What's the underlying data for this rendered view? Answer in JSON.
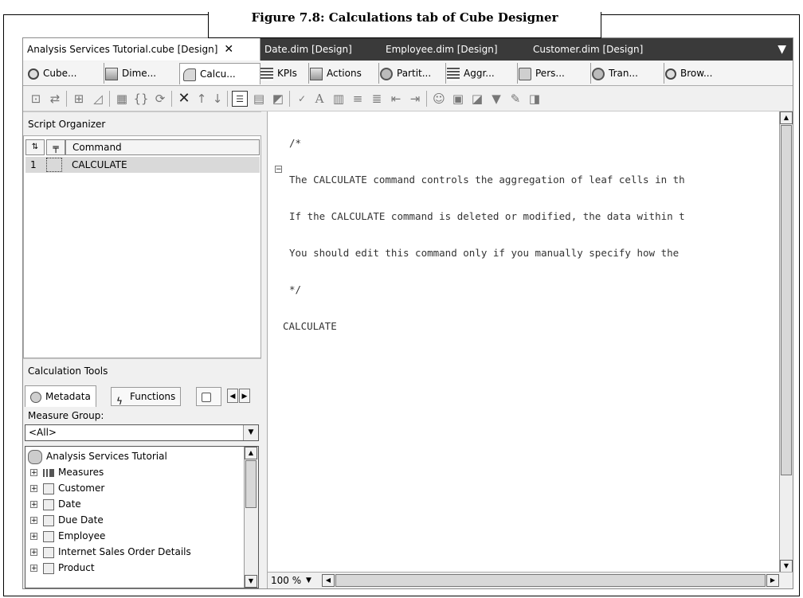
{
  "figure": {
    "caption": "Figure 7.8: Calculations tab of Cube Designer"
  },
  "doc_tabs": [
    {
      "label": "Analysis Services Tutorial.cube [Design]",
      "active": true
    },
    {
      "label": "Date.dim [Design]",
      "active": false
    },
    {
      "label": "Employee.dim [Design]",
      "active": false
    },
    {
      "label": "Customer.dim [Design]",
      "active": false
    }
  ],
  "doc_tab_close": "✕",
  "doc_tabs_overflow": "▼",
  "designer_tabs": [
    {
      "label": "Cube...",
      "icon": "cube-structure-icon"
    },
    {
      "label": "Dime...",
      "icon": "dimension-usage-icon"
    },
    {
      "label": "Calcu...",
      "icon": "calculations-icon",
      "active": true
    },
    {
      "label": "KPIs",
      "icon": "kpi-icon"
    },
    {
      "label": "Actions",
      "icon": "actions-icon"
    },
    {
      "label": "Partit...",
      "icon": "partitions-icon"
    },
    {
      "label": "Aggr...",
      "icon": "aggregations-icon"
    },
    {
      "label": "Pers...",
      "icon": "perspectives-icon"
    },
    {
      "label": "Tran...",
      "icon": "translations-icon"
    },
    {
      "label": "Brow...",
      "icon": "browser-icon"
    }
  ],
  "script_organizer": {
    "title": "Script Organizer",
    "column_command": "Command",
    "rows": [
      {
        "num": "1",
        "command": "CALCULATE"
      }
    ]
  },
  "calc_tools": {
    "title": "Calculation Tools",
    "tabs": [
      "Metadata",
      "Functions"
    ],
    "measure_group_label": "Measure Group:",
    "measure_group_value": "<All>",
    "tree_root": "Analysis Services Tutorial",
    "tree_items": [
      "Measures",
      "Customer",
      "Date",
      "Due Date",
      "Employee",
      "Internet Sales Order Details",
      "Product"
    ]
  },
  "editor": {
    "lines": [
      "/*",
      "The CALCULATE command controls the aggregation of leaf cells in th",
      "If the CALCULATE command is deleted or modified, the data within t",
      "You should edit this command only if you manually specify how the",
      "*/",
      "CALCULATE"
    ],
    "zoom": "100 %"
  }
}
